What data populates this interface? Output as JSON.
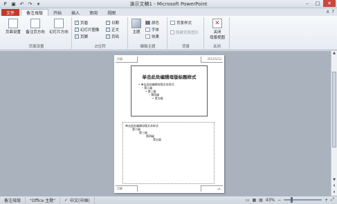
{
  "title": "演示文稿1 - Microsoft PowerPoint",
  "tabs": [
    "文件",
    "备注母版",
    "开始",
    "插入",
    "审阅",
    "视图"
  ],
  "ribbon": {
    "page_setup": {
      "btn1": "页面设置",
      "btn2": "备注页方向",
      "btn3": "幻灯片方向",
      "label": "页面设置"
    },
    "placeholders": {
      "c1": "页眉",
      "c2": "幻灯片图像",
      "c3": "页脚",
      "c4": "日期",
      "c5": "正文",
      "c6": "页码",
      "label": "占位符"
    },
    "edit_theme": {
      "btn": "主题",
      "colors": "颜色",
      "fonts": "字体",
      "effects": "效果",
      "label": "编辑主题"
    },
    "background": {
      "styles": "背景样式",
      "hide": "隐藏背景图形",
      "label": "背景"
    },
    "close": {
      "btn": "关闭\n母版视图",
      "label": "关闭"
    }
  },
  "page": {
    "title": "单击此处编辑母版标题样式",
    "body": [
      "• 单击此处编辑母版文本样式",
      "– 第二级",
      "• 第三级",
      "– 第四级",
      "» 第五级"
    ],
    "notes": [
      "单击此处编辑母版文本样式",
      "第二级",
      "第三级",
      "第四级",
      "第五级"
    ],
    "footer_left": "页眉",
    "date": "2012/5/12",
    "footer_bottom": "页脚",
    "page_num": "‹#›"
  },
  "status": {
    "view": "备注母版",
    "theme": "\"Office 主题\"",
    "lang": "中文(中国)",
    "zoom": "43%",
    "zoom_fraction": 0.43
  }
}
